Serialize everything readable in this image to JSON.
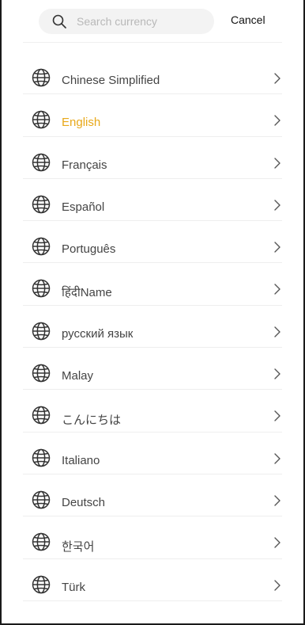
{
  "search": {
    "placeholder": "Search currency",
    "cancel_label": "Cancel"
  },
  "languages": [
    {
      "label": "Chinese Simplified",
      "icon": "globe-icon"
    },
    {
      "label": "English",
      "icon": "globe-icon",
      "selected": true
    },
    {
      "label": "Français",
      "icon": "globe-icon"
    },
    {
      "label": "Español",
      "icon": "globe-icon"
    },
    {
      "label": "Português",
      "icon": "globe-icon"
    },
    {
      "label": "हिंदीName",
      "icon": "globe-icon"
    },
    {
      "label": "русский язык",
      "icon": "globe-icon"
    },
    {
      "label": "Malay",
      "icon": "globe-icon"
    },
    {
      "label": "こんにちは",
      "icon": "globe-icon"
    },
    {
      "label": "Italiano",
      "icon": "globe-icon"
    },
    {
      "label": "Deutsch",
      "icon": "globe-icon"
    },
    {
      "label": "한국어",
      "icon": "globe-icon"
    },
    {
      "label": "Türk",
      "icon": "globe-icon"
    }
  ],
  "colors": {
    "selected": "#e8a819",
    "text": "#444444",
    "search_bg": "#f3f3f3"
  }
}
